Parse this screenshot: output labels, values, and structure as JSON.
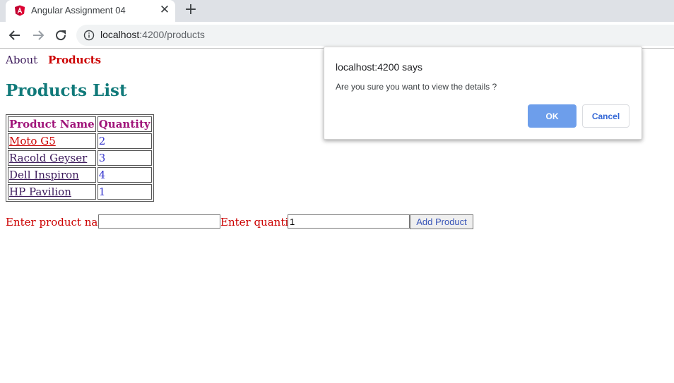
{
  "browser": {
    "tab_title": "Angular Assignment 04",
    "url_host": "localhost",
    "url_rest": ":4200/products",
    "icons": {
      "favicon": "angular-logo-icon",
      "close_tab": "close-icon",
      "new_tab": "plus-icon",
      "back": "arrow-left-icon",
      "forward": "arrow-right-icon",
      "reload": "reload-icon",
      "site_info": "info-icon"
    },
    "tab_close_glyph": "✕",
    "new_tab_glyph": "+"
  },
  "nav": {
    "about": "About",
    "products": "Products"
  },
  "page": {
    "title": "Products List",
    "table": {
      "headers": [
        "Product Name",
        "Quantity"
      ],
      "rows": [
        {
          "name": "Moto G5",
          "quantity": "2"
        },
        {
          "name": "Racold Geyser",
          "quantity": "3"
        },
        {
          "name": "Dell Inspiron",
          "quantity": "4"
        },
        {
          "name": "HP Pavilion",
          "quantity": "1"
        }
      ]
    },
    "form": {
      "name_label": "Enter product name:",
      "name_value": "",
      "quantity_label": "Enter quantity:",
      "quantity_value": "1",
      "add_button": "Add Product"
    }
  },
  "dialog": {
    "title": "localhost:4200 says",
    "message": "Are you sure you want to view the details ?",
    "ok": "OK",
    "cancel": "Cancel"
  },
  "colors": {
    "tab_strip": "#dee1e6",
    "title": "#117a7a",
    "active_nav": "#cc0000",
    "table_header": "#a0157a",
    "ok_button": "#6d9eeb"
  }
}
